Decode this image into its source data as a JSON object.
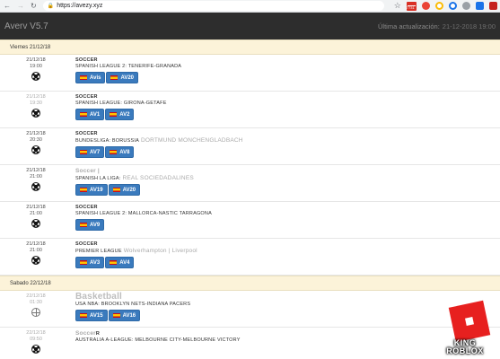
{
  "browser": {
    "url": "https://avezy.xyz",
    "gmail_badge": "7731"
  },
  "header": {
    "title": "Averv V5.7",
    "last_update_label": "Última actualización:",
    "last_update_value": "21-12-2018 19:00"
  },
  "days": [
    {
      "label": "Viernes 21/12/18",
      "events": [
        {
          "date": "21/12/18",
          "time": "19:00",
          "sport": "SOCCER",
          "match": "SPANISH LEAGUE 2: TENERIFE-GRANADA",
          "ball": "soccer",
          "faded": false,
          "streams": [
            "Avis",
            "AV20"
          ],
          "overlay": ""
        },
        {
          "date": "21/12/18",
          "time": "19:30",
          "sport": "SOCCER",
          "match": "SPANISH LEAGUE: GIRONA-GETAFE",
          "ball": "soccer",
          "faded": true,
          "streams": [
            "AV1",
            "AV2"
          ],
          "overlay": ""
        },
        {
          "date": "21/12/18",
          "time": "20:30",
          "sport": "SOCCER",
          "match": "BUNDESLIGA: BORUSSIA",
          "match_suffix": "DORTMUND MONCHENGLADBACH",
          "ball": "soccer",
          "faded": false,
          "streams": [
            "AV7",
            "AV8"
          ],
          "overlay": ""
        },
        {
          "date": "21/12/18",
          "time": "21:00",
          "sport": "Soccer |",
          "match": "SPANISH LA LIGA:",
          "match_suffix": "REAL SOCIEDADALINES",
          "ball": "soccer",
          "faded": false,
          "streams": [
            "AV19",
            "AV20"
          ],
          "overlay": "",
          "sport_faded": true
        },
        {
          "date": "21/12/18",
          "time": "21:00",
          "sport": "SOCCER",
          "match": "SPANISH LEAGUE 2: MALLORCA-NASTIC TARRAGONA",
          "ball": "soccer",
          "faded": false,
          "streams": [
            "AV9"
          ],
          "overlay": ""
        },
        {
          "date": "21/12/18",
          "time": "21:00",
          "sport": "SOCCER",
          "match": "PREMIER LEAGUE",
          "match_suffix": "Wolverhampton | Liverpool",
          "ball": "soccer",
          "faded": false,
          "streams": [
            "AV3",
            "AV4"
          ],
          "overlay": ""
        }
      ]
    },
    {
      "label": "Sabado 22/12/18",
      "events": [
        {
          "date": "22/12/18",
          "time": "01:30",
          "sport": "Basketball",
          "match": "USA NBA: BROOKLYN NETS-INDIANA PACERS",
          "ball": "basketball",
          "faded": true,
          "streams": [
            "AV15",
            "AV16"
          ],
          "overlay": "",
          "sport_big": true
        },
        {
          "date": "22/12/18",
          "time": "09:50",
          "sport": "Soccer",
          "sport_tail": "R",
          "match": "AUSTRALIA A-LEAGUE: MELBOURNE CITY-MELBOURNE VICTORY",
          "ball": "soccer",
          "faded": true,
          "streams": [],
          "overlay": "",
          "sport_faded": true
        }
      ]
    }
  ],
  "logo": {
    "line1": "KING",
    "line2": "ROBLOX"
  }
}
